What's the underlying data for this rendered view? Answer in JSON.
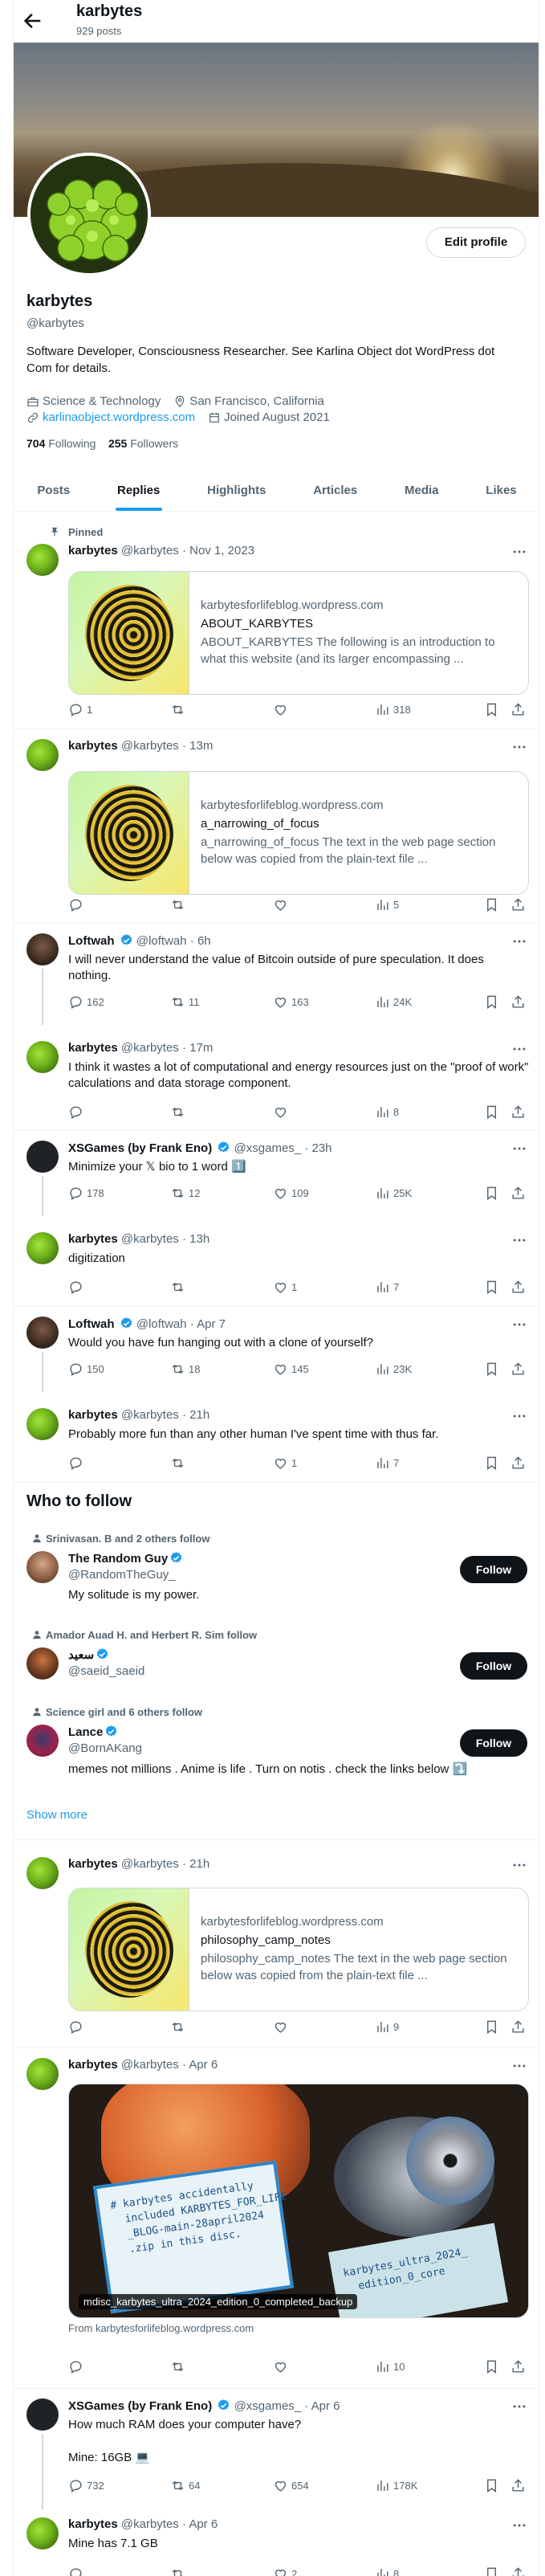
{
  "header": {
    "title": "karbytes",
    "posts_count": "929 posts"
  },
  "profile": {
    "name": "karbytes",
    "handle": "@karbytes",
    "edit_label": "Edit profile",
    "bio": "Software Developer, Consciousness Researcher. See Karlina Object dot WordPress dot Com for details.",
    "category": "Science & Technology",
    "location": "San Francisco, California",
    "website": "karlinaobject.wordpress.com",
    "joined": "Joined August 2021",
    "following_count": "704",
    "following_label": "Following",
    "followers_count": "255",
    "followers_label": "Followers"
  },
  "tabs": [
    "Posts",
    "Replies",
    "Highlights",
    "Articles",
    "Media",
    "Likes"
  ],
  "active_tab": "Replies",
  "posts": [
    {
      "pinned_label": "Pinned",
      "name": "karbytes",
      "handle": "@karbytes",
      "time": "Nov 1, 2023",
      "card": {
        "domain": "karbytesforlifeblog.wordpress.com",
        "title": "ABOUT_KARBYTES",
        "desc": "ABOUT_KARBYTES The following is an introduction to what this website (and its larger encompassing ..."
      },
      "replies": "1",
      "reposts": "",
      "likes": "",
      "views": "318"
    },
    {
      "name": "karbytes",
      "handle": "@karbytes",
      "time": "13m",
      "card": {
        "domain": "karbytesforlifeblog.wordpress.com",
        "title": "a_narrowing_of_focus",
        "desc": "a_narrowing_of_focus The text in the web page section below was copied from the plain-text file ..."
      },
      "replies": "",
      "reposts": "",
      "likes": "",
      "views": "5"
    },
    {
      "name": "Loftwah",
      "handle": "@loftwah",
      "time": "6h",
      "text": "I will never understand the value of Bitcoin outside of pure speculation. It does nothing.",
      "replies": "162",
      "reposts": "11",
      "likes": "163",
      "views": "24K"
    },
    {
      "name": "karbytes",
      "handle": "@karbytes",
      "time": "17m",
      "text": "I think it wastes a lot of computational and energy resources just on the \"proof of work\" calculations and data storage component.",
      "replies": "",
      "reposts": "",
      "likes": "",
      "views": "8"
    },
    {
      "name": "XSGames (by Frank Eno)",
      "handle": "@xsgames_",
      "time": "23h",
      "text": "Minimize your 𝕏 bio to 1 word 1️⃣",
      "replies": "178",
      "reposts": "12",
      "likes": "109",
      "views": "25K"
    },
    {
      "name": "karbytes",
      "handle": "@karbytes",
      "time": "13h",
      "text": "digitization",
      "replies": "",
      "reposts": "",
      "likes": "1",
      "views": "7"
    },
    {
      "name": "Loftwah",
      "handle": "@loftwah",
      "time": "Apr 7",
      "text": "Would you have fun hanging out with a clone of yourself?",
      "replies": "150",
      "reposts": "18",
      "likes": "145",
      "views": "23K"
    },
    {
      "name": "karbytes",
      "handle": "@karbytes",
      "time": "21h",
      "text": "Probably more fun than any other human I've spent time with thus far.",
      "replies": "",
      "reposts": "",
      "likes": "1",
      "views": "7"
    }
  ],
  "who_to_follow": {
    "title": "Who to follow",
    "follow_label": "Follow",
    "show_more": "Show more",
    "items": [
      {
        "context": "Srinivasan. B and 2 others follow",
        "name": "The Random Guy",
        "handle": "@RandomTheGuy_",
        "bio": "My solitude is my power."
      },
      {
        "context": "Amador Auad H. and Herbert R. Sim follow",
        "name": "سعيد",
        "handle": "@saeid_saeid",
        "bio": ""
      },
      {
        "context": "Science girl and 6 others follow",
        "name": "Lance",
        "handle": "@BornAKang",
        "bio": "memes not millions . Anime is life . Turn on notis . check the links below ⤵️"
      }
    ]
  },
  "posts_after": [
    {
      "name": "karbytes",
      "handle": "@karbytes",
      "time": "21h",
      "card": {
        "domain": "karbytesforlifeblog.wordpress.com",
        "title": "philosophy_camp_notes",
        "desc": "philosophy_camp_notes The text in the web page section below was copied from the plain-text file ..."
      },
      "replies": "",
      "reposts": "",
      "likes": "",
      "views": "9"
    },
    {
      "name": "karbytes",
      "handle": "@karbytes",
      "time": "Apr 6",
      "photo": {
        "alt_label": "mdisc_karbytes_ultra_2024_edition_0_completed_backup",
        "note_text": "# karbytes accidentally\n  included KARBYTES_FOR_LIFE\n  _BLOG-main-28april2024\n  .zip in this disc.",
        "disc_text": "karbytes_ultra_2024_\n  edition_0_core"
      },
      "from": "From karbytesforlifeblog.wordpress.com",
      "replies": "",
      "reposts": "",
      "likes": "",
      "views": "10"
    },
    {
      "name": "XSGames (by Frank Eno)",
      "handle": "@xsgames_",
      "time": "Apr 6",
      "text": "How much RAM does your computer have?",
      "text2": "Mine: 16GB 💻",
      "replies": "732",
      "reposts": "64",
      "likes": "654",
      "views": "178K"
    },
    {
      "name": "karbytes",
      "handle": "@karbytes",
      "time": "Apr 6",
      "text": "Mine has 7.1 GB",
      "replies": "",
      "reposts": "",
      "likes": "2",
      "views": "8"
    }
  ],
  "colors": {
    "accent": "#1d9bf0",
    "text": "#0f1419",
    "muted": "#536471",
    "border": "#eff3f4"
  }
}
